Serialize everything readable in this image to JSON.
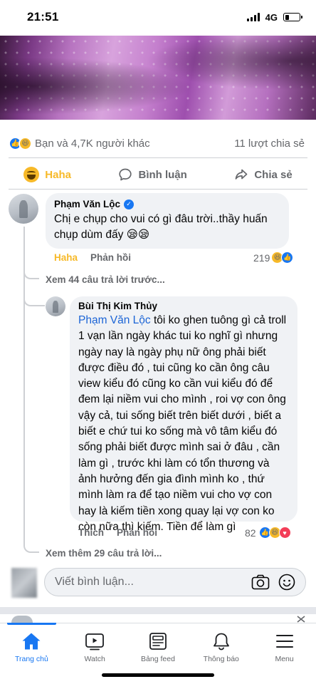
{
  "status_bar": {
    "time": "21:51",
    "network": "4G",
    "battery_level": 0.3
  },
  "post": {
    "reaction_summary": "Bạn và 4,7K người khác",
    "share_count": "11 lượt chia sẻ",
    "actions": {
      "react": "Haha",
      "comment": "Bình luận",
      "share": "Chia sẻ"
    }
  },
  "comments": {
    "main": {
      "author": "Phạm Văn Lộc",
      "text": "Chị e chụp cho vui có gì đâu trời..thầy huấn chụp dùm đấy 😪😪",
      "reaction_label": "Haha",
      "reply_label": "Phản hồi",
      "reaction_count": "219"
    },
    "view_previous": "Xem 44 câu trả lời trước...",
    "reply": {
      "author": "Bùi Thị Kim Thủy",
      "mention": "Phạm Văn Lộc",
      "text": " tôi ko ghen tuông gì cả troll 1 vạn lần ngày khác tui ko nghĩ gì nhưng ngày nay là ngày phụ nữ ông phải biết được điều đó , tui cũng ko cần ông câu view kiểu đó cũng ko cần vui kiểu đó để đem lại niềm vui cho mình , roi vợ con ông vậy cả, tui sống biết trên biết dưới , biết a biết e chứ tui ko sống mà vô tâm kiểu đó sống phải biết được mình sai ở đâu , cần làm gì , trước khi làm có tổn thương và ảnh hưởng đến gia đình mình ko , thứ mình làm ra để tạo niềm vui cho vợ con hay là kiếm tiền xong quay lại vợ con ko còn nữa thì kiếm. Tiền để làm gì",
      "like_label": "Thích",
      "reply_label": "Phản hồi",
      "reaction_count": "82"
    },
    "view_more": "Xem thêm 29 câu trả lời..."
  },
  "composer": {
    "placeholder": "Viết bình luận..."
  },
  "tabs": [
    {
      "label": "Trang chủ",
      "icon": "home-icon",
      "active": true
    },
    {
      "label": "Watch",
      "icon": "watch-icon",
      "active": false
    },
    {
      "label": "Bảng feed",
      "icon": "feed-icon",
      "active": false
    },
    {
      "label": "Thông báo",
      "icon": "bell-icon",
      "active": false
    },
    {
      "label": "Menu",
      "icon": "menu-icon",
      "active": false
    }
  ],
  "colors": {
    "accent": "#1877f2",
    "haha": "#f7b928",
    "mention": "#1b64d6",
    "muted": "#65676b",
    "bubble": "#f0f2f5"
  }
}
